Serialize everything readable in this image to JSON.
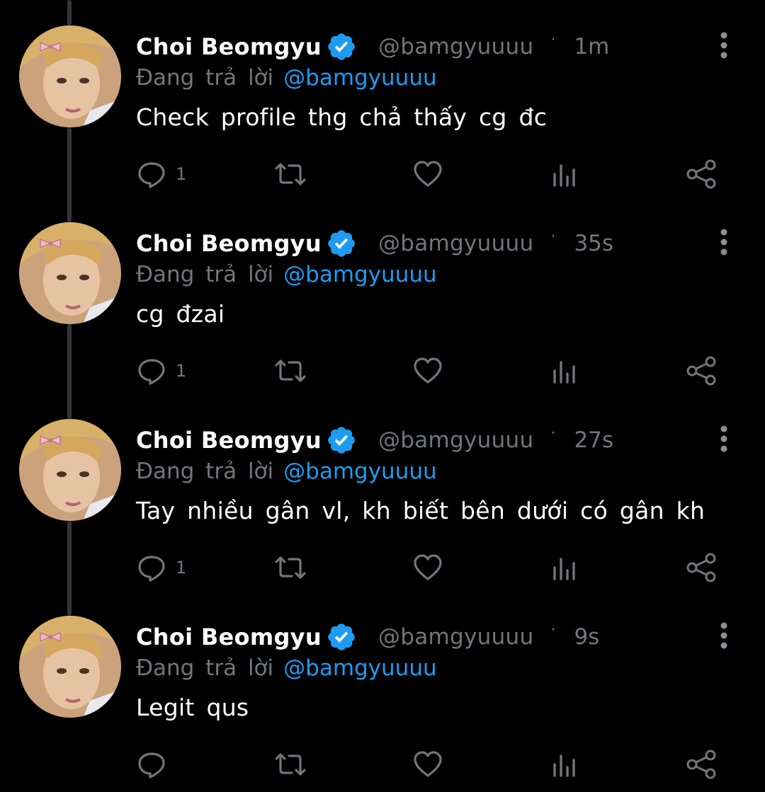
{
  "tweets": [
    {
      "name": "Choi Beomgyu",
      "handle": "@bamgyuuuu",
      "time": "1m",
      "replying_label": "Đang trả lời",
      "replying_to": "@bamgyuuuu",
      "text": "Check profile thg chả thấy cg đc",
      "reply_count": "1"
    },
    {
      "name": "Choi Beomgyu",
      "handle": "@bamgyuuuu",
      "time": "35s",
      "replying_label": "Đang trả lời",
      "replying_to": "@bamgyuuuu",
      "text": "cg đzai",
      "reply_count": "1"
    },
    {
      "name": "Choi Beomgyu",
      "handle": "@bamgyuuuu",
      "time": "27s",
      "replying_label": "Đang trả lời",
      "replying_to": "@bamgyuuuu",
      "text": "Tay nhiều gân vl, kh biết bên dưới có gân kh",
      "reply_count": "1"
    },
    {
      "name": "Choi Beomgyu",
      "handle": "@bamgyuuuu",
      "time": "9s",
      "replying_label": "Đang trả lời",
      "replying_to": "@bamgyuuuu",
      "text": "Legit qus",
      "reply_count": ""
    }
  ],
  "separator": "·",
  "icons": {
    "verified": "verified-badge-icon",
    "more": "more-vertical-icon",
    "reply": "reply-icon",
    "retweet": "retweet-icon",
    "like": "heart-icon",
    "views": "views-icon",
    "share": "share-icon"
  },
  "colors": {
    "background": "#000000",
    "primary_text": "#ffffff",
    "secondary_text": "#71767b",
    "accent": "#1d9bf0",
    "thread_line": "#333639"
  }
}
